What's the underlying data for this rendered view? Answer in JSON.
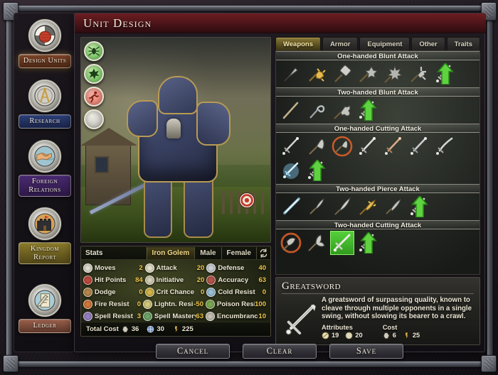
{
  "window": {
    "title": "Unit Design"
  },
  "sidebar": {
    "items": [
      {
        "label": "Design Units",
        "icon": "fist-icon",
        "name": "sidebar-item-design-units",
        "active": true
      },
      {
        "label": "Research",
        "icon": "compass-icon",
        "name": "sidebar-item-research",
        "active": false
      },
      {
        "label": "Foreign Relations",
        "icon": "handshake-icon",
        "name": "sidebar-item-foreign-relations",
        "active": false
      },
      {
        "label": "Kingdom Report",
        "icon": "castle-icon",
        "name": "sidebar-item-kingdom-report",
        "active": false
      },
      {
        "label": "Ledger",
        "icon": "scroll-icon",
        "name": "sidebar-item-ledger",
        "active": false
      }
    ]
  },
  "portrait": {
    "traits": [
      {
        "icon": "spider-trait-icon",
        "color": "green"
      },
      {
        "icon": "burst-trait-icon",
        "color": "green"
      },
      {
        "icon": "running-trait-icon",
        "color": "red"
      },
      {
        "icon": "empty-trait-icon",
        "color": "empty"
      }
    ]
  },
  "stats": {
    "header_title": "Stats",
    "unit_name": "Iron Golem",
    "gender_male": "Male",
    "gender_female": "Female",
    "randomize_icon": "randomize-icon",
    "rows": [
      [
        {
          "icon": "moves-icon",
          "color": "#e4e1d4",
          "label": "Moves",
          "value": "2"
        },
        {
          "icon": "attack-icon",
          "color": "#e9e5cf",
          "label": "Attack",
          "value": "20"
        },
        {
          "icon": "defense-icon",
          "color": "#cfd5d8",
          "label": "Defense",
          "value": "40"
        }
      ],
      [
        {
          "icon": "hitpoints-icon",
          "color": "#c24a3e",
          "label": "Hit Points",
          "value": "84"
        },
        {
          "icon": "initiative-icon",
          "color": "#dcd6bd",
          "label": "Initiative",
          "value": "20"
        },
        {
          "icon": "accuracy-icon",
          "color": "#b8584a",
          "label": "Accuracy",
          "value": "63"
        }
      ],
      [
        {
          "icon": "dodge-icon",
          "color": "#b98a4e",
          "label": "Dodge",
          "value": "0"
        },
        {
          "icon": "crit-icon",
          "color": "#d8b94a",
          "label": "Crit Chance",
          "value": "0"
        },
        {
          "icon": "cold-icon",
          "color": "#9fc6dc",
          "label": "Cold Resist",
          "value": "0"
        }
      ],
      [
        {
          "icon": "fire-icon",
          "color": "#d87a3a",
          "label": "Fire Resist",
          "value": "0"
        },
        {
          "icon": "lightning-icon",
          "color": "#d8cf7e",
          "label": "Lightn. Resist",
          "value": "-50"
        },
        {
          "icon": "poison-icon",
          "color": "#7fae52",
          "label": "Poison Resist",
          "value": "100"
        }
      ],
      [
        {
          "icon": "spellresist-icon",
          "color": "#9a83c6",
          "label": "Spell Resist",
          "value": "3"
        },
        {
          "icon": "spellmastery-icon",
          "color": "#6fa96a",
          "label": "Spell Mastery",
          "value": "63"
        },
        {
          "icon": "encumbrance-icon",
          "color": "#c9c6b6",
          "label": "Encumbrance",
          "value": "10"
        }
      ]
    ],
    "total_cost_label": "Total Cost",
    "total_cost": [
      {
        "icon": "material-icon",
        "value": "36"
      },
      {
        "icon": "mana-icon",
        "value": "30"
      },
      {
        "icon": "gold-icon",
        "value": "225"
      }
    ]
  },
  "tabs": [
    {
      "label": "Weapons",
      "active": true
    },
    {
      "label": "Armor",
      "active": false
    },
    {
      "label": "Equipment",
      "active": false
    },
    {
      "label": "Other",
      "active": false
    },
    {
      "label": "Traits",
      "active": false
    }
  ],
  "weapon_categories": [
    {
      "title": "One-handed Blunt Attack",
      "items": [
        {
          "icon": "club-icon",
          "selected": false,
          "upgrade": false
        },
        {
          "icon": "gold-mace-icon",
          "selected": false,
          "upgrade": false
        },
        {
          "icon": "hammer-icon",
          "selected": false,
          "upgrade": false
        },
        {
          "icon": "morningstar-icon",
          "selected": false,
          "upgrade": false
        },
        {
          "icon": "flail-icon",
          "selected": false,
          "upgrade": false
        },
        {
          "icon": "mace-icon",
          "selected": false,
          "upgrade": false
        },
        {
          "icon": "sword-icon",
          "selected": false,
          "upgrade": true
        }
      ]
    },
    {
      "title": "Two-handed Blunt Attack",
      "items": [
        {
          "icon": "staff-icon",
          "selected": false,
          "upgrade": false
        },
        {
          "icon": "crook-icon",
          "selected": false,
          "upgrade": false
        },
        {
          "icon": "maul-icon",
          "selected": false,
          "upgrade": false
        },
        {
          "icon": "sword-icon",
          "selected": false,
          "upgrade": true
        }
      ]
    },
    {
      "title": "One-handed Cutting Attack",
      "items": [
        {
          "icon": "shortsword-icon",
          "selected": false,
          "upgrade": false
        },
        {
          "icon": "axe-icon",
          "selected": false,
          "upgrade": false
        },
        {
          "icon": "fire-axe-icon",
          "selected": false,
          "upgrade": false
        },
        {
          "icon": "longsword-icon",
          "selected": false,
          "upgrade": false
        },
        {
          "icon": "copper-sword-icon",
          "selected": false,
          "upgrade": false
        },
        {
          "icon": "steel-sword-icon",
          "selected": false,
          "upgrade": false
        },
        {
          "icon": "saber-icon",
          "selected": false,
          "upgrade": false
        },
        {
          "icon": "ice-sword-icon",
          "selected": false,
          "upgrade": false
        },
        {
          "icon": "sword-icon",
          "selected": false,
          "upgrade": true
        }
      ]
    },
    {
      "title": "Two-handed Pierce Attack",
      "items": [
        {
          "icon": "ice-spear-icon",
          "selected": false,
          "upgrade": false
        },
        {
          "icon": "spear-icon",
          "selected": false,
          "upgrade": false
        },
        {
          "icon": "pike-icon",
          "selected": false,
          "upgrade": false
        },
        {
          "icon": "gold-spear-icon",
          "selected": false,
          "upgrade": false
        },
        {
          "icon": "lance-icon",
          "selected": false,
          "upgrade": false
        },
        {
          "icon": "sword-icon",
          "selected": false,
          "upgrade": true
        }
      ]
    },
    {
      "title": "Two-handed Cutting Attack",
      "items": [
        {
          "icon": "fire-greataxe-icon",
          "selected": false,
          "upgrade": false
        },
        {
          "icon": "greataxe-icon",
          "selected": false,
          "upgrade": false
        },
        {
          "icon": "greatsword-icon",
          "selected": true,
          "upgrade": false
        },
        {
          "icon": "sword-icon",
          "selected": false,
          "upgrade": true
        }
      ]
    }
  ],
  "description": {
    "title": "Greatsword",
    "icon": "greatsword-icon",
    "text": "A greatsword of surpassing quality, known to cleave through multiple opponents in a single swing, without slowing its bearer to a crawl.",
    "attributes_label": "Attributes",
    "attributes": [
      {
        "icon": "attack-icon",
        "value": "19"
      },
      {
        "icon": "weight-icon",
        "value": "20"
      }
    ],
    "cost_label": "Cost",
    "cost": [
      {
        "icon": "material-icon",
        "value": "6"
      },
      {
        "icon": "gold-icon",
        "value": "25"
      }
    ]
  },
  "footer": {
    "buttons": [
      {
        "label": "Cancel",
        "name": "cancel-button"
      },
      {
        "label": "Clear",
        "name": "clear-button"
      },
      {
        "label": "Save",
        "name": "save-button"
      }
    ]
  },
  "colors": {
    "accent_gold": "#f0c64a",
    "title_red": "#5a171b",
    "selected_green": "#3fb426"
  }
}
